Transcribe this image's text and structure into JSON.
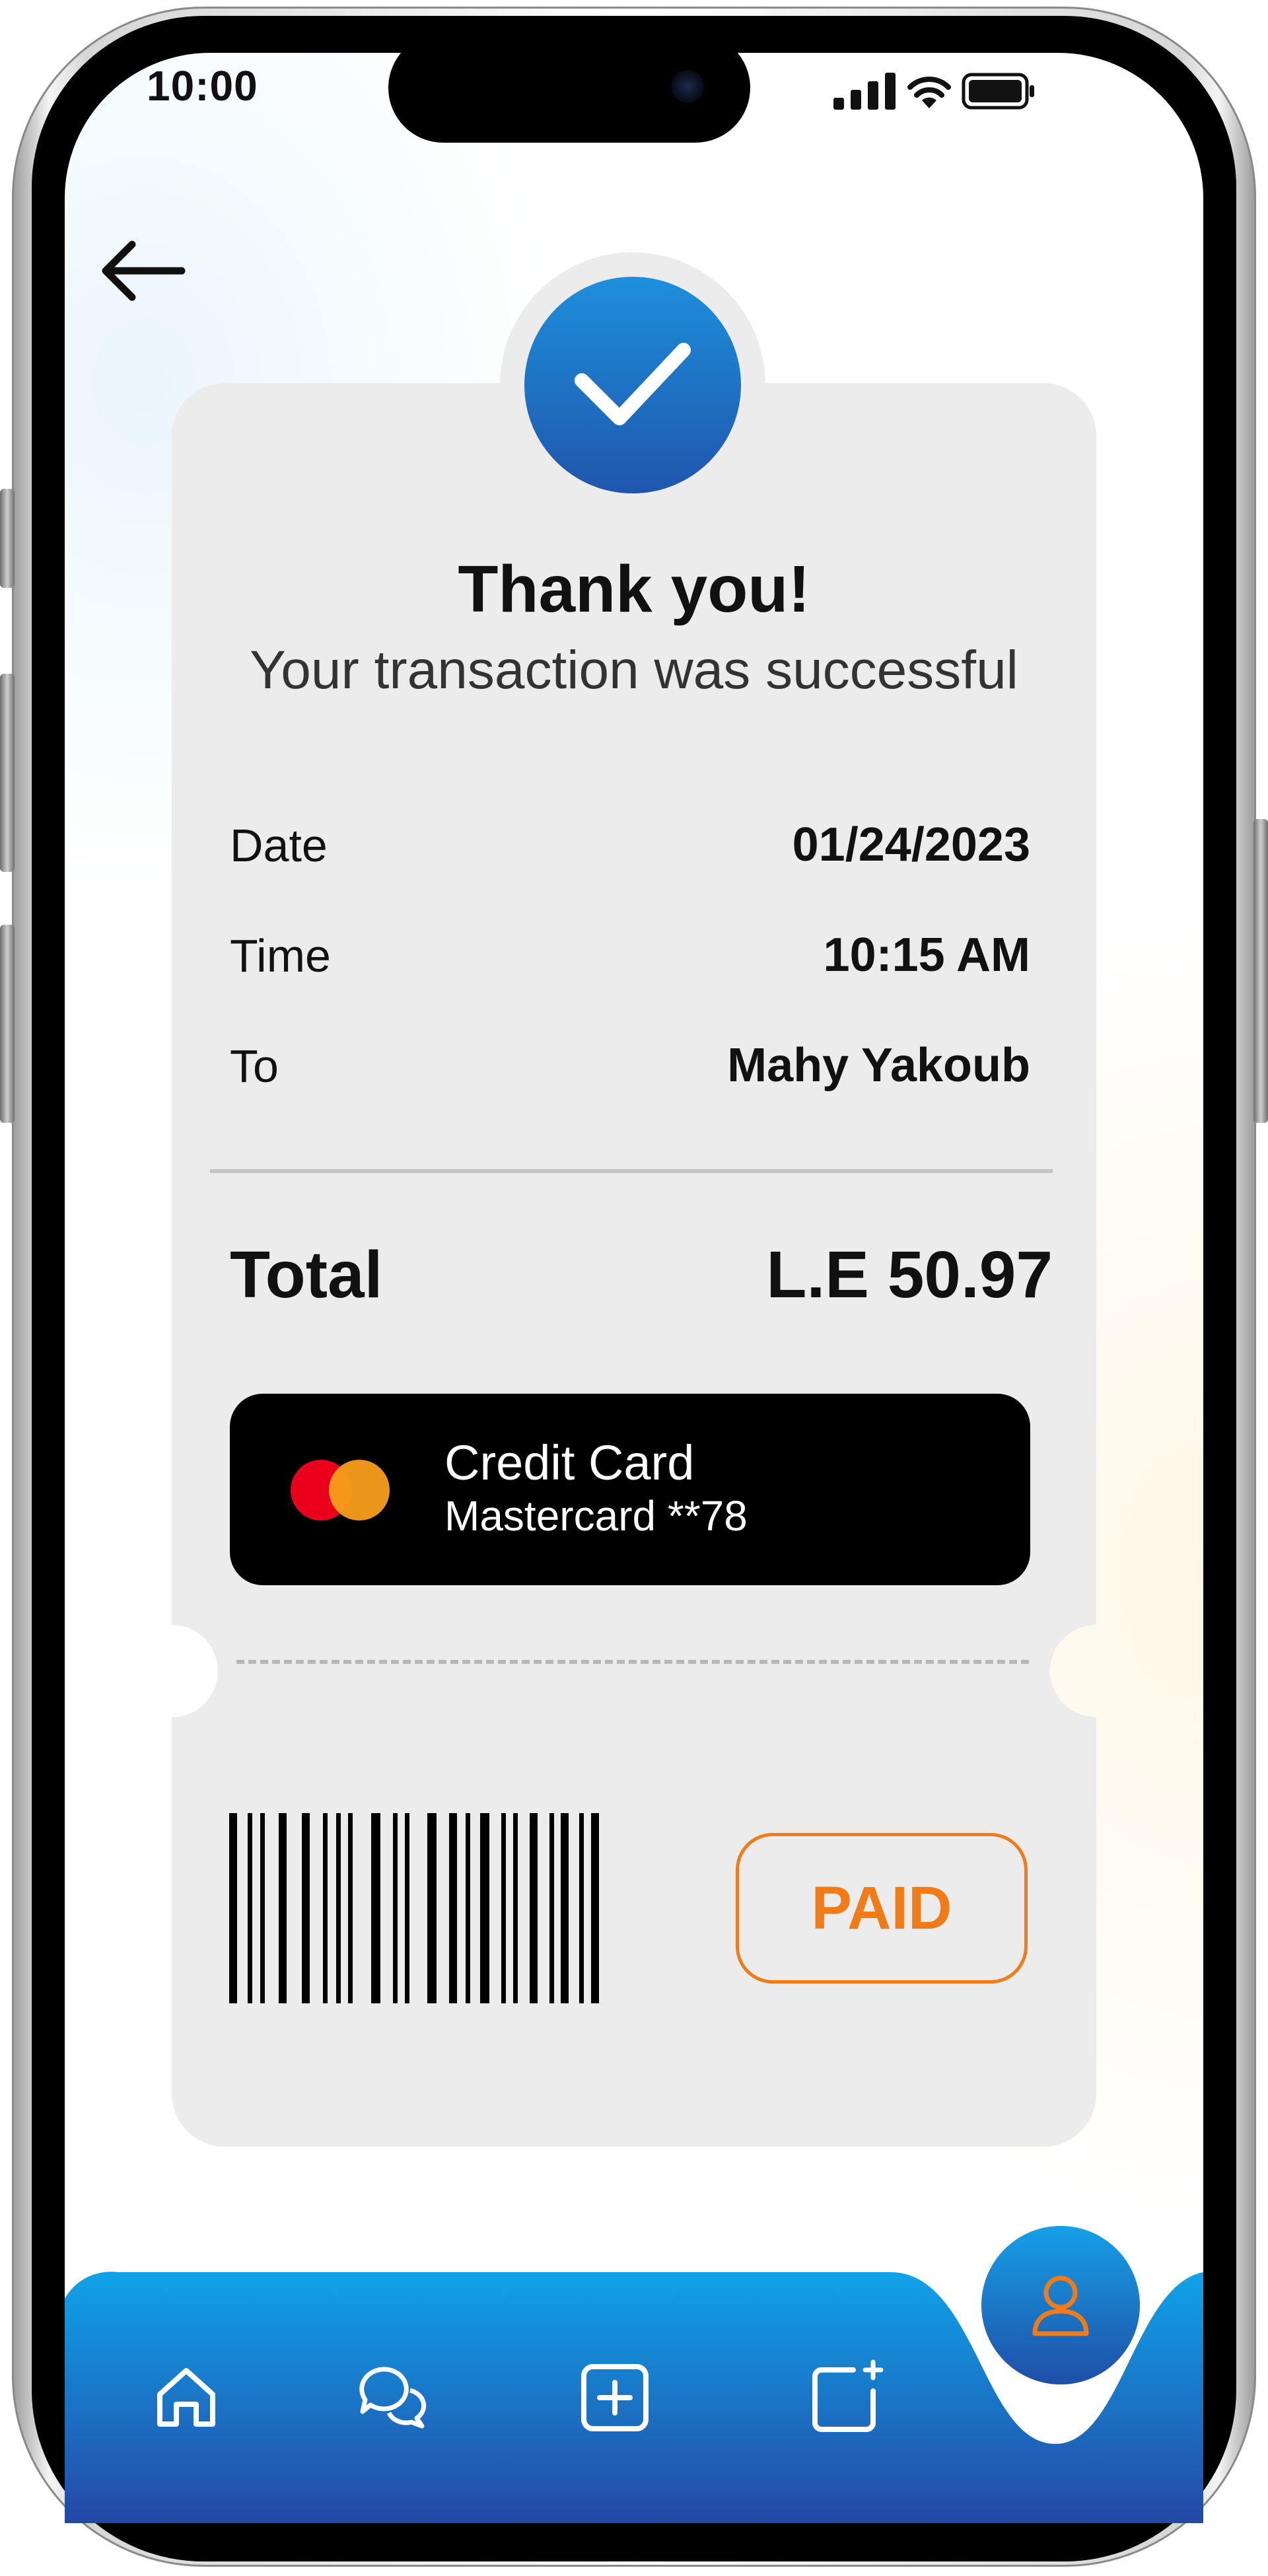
{
  "status_bar": {
    "time": "10:00"
  },
  "receipt": {
    "title": "Thank you!",
    "subtitle": "Your transaction was successful",
    "rows": [
      {
        "label": "Date",
        "value": "01/24/2023"
      },
      {
        "label": "Time",
        "value": "10:15 AM"
      },
      {
        "label": "To",
        "value": "Mahy Yakoub"
      }
    ],
    "total_label": "Total",
    "total_value": "L.E 50.97",
    "payment": {
      "title": "Credit Card",
      "subtitle": "Mastercard **78",
      "brand_icon": "mastercard-logo"
    },
    "paid_label": "PAID"
  },
  "nav": {
    "items": [
      "home-icon",
      "chat-icon",
      "add-icon",
      "new-post-icon"
    ],
    "active": "profile-icon"
  },
  "colors": {
    "accent_blue": "#1f7fd6",
    "accent_orange": "#f17c17",
    "card_bg": "#ececec",
    "payment_card_bg": "#000000"
  }
}
